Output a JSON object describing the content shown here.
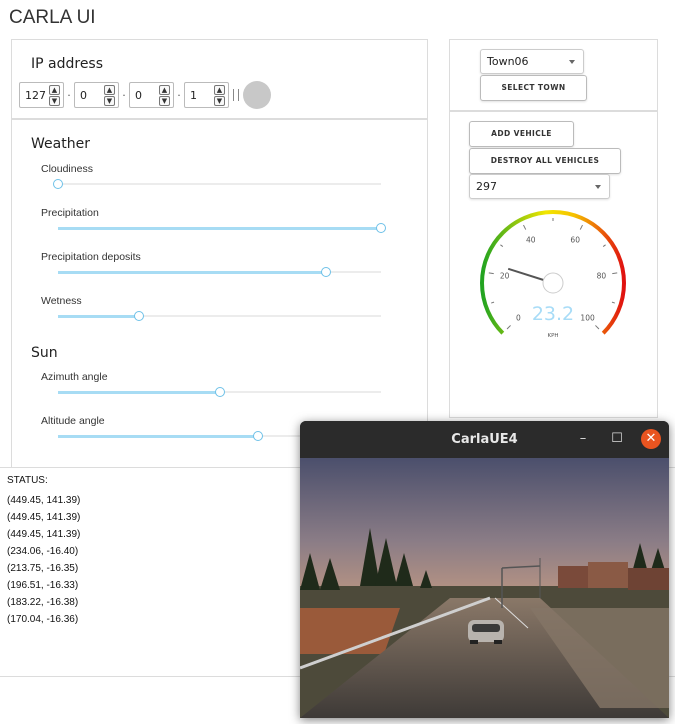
{
  "app": {
    "title": "CARLA UI"
  },
  "ip": {
    "title": "IP address",
    "octets": [
      "127",
      "0",
      "0",
      "1"
    ],
    "separator": "·",
    "up_glyph": "▲",
    "down_glyph": "▼"
  },
  "weather": {
    "title": "Weather",
    "sliders": [
      {
        "label": "Cloudiness",
        "value": 0
      },
      {
        "label": "Precipitation",
        "value": 100
      },
      {
        "label": "Precipitation deposits",
        "value": 83
      },
      {
        "label": "Wetness",
        "value": 25
      }
    ]
  },
  "sun": {
    "title": "Sun",
    "sliders": [
      {
        "label": "Azimuth angle",
        "value": 50
      },
      {
        "label": "Altitude angle",
        "value": 62
      }
    ]
  },
  "town": {
    "selected": "Town06",
    "select_button": "SELECT TOWN"
  },
  "vehicle": {
    "add_button": "ADD VEHICLE",
    "destroy_button": "DESTROY ALL VEHICLES",
    "selected_id": "297"
  },
  "speedometer": {
    "value": "23.2",
    "unit": "KPH",
    "min": 0,
    "max": 100,
    "ticks": [
      "0",
      "20",
      "40",
      "60",
      "80",
      "100"
    ],
    "speed_value": 23.2,
    "colors": {
      "low": "#21a321",
      "mid": "#f2e600",
      "high": "#e01010",
      "value": "#a8dcf7"
    }
  },
  "status": {
    "label": "STATUS:",
    "lines": [
      "(449.45, 141.39)",
      "(449.45, 141.39)",
      "(449.45, 141.39)",
      "(234.06, -16.40)",
      "(213.75, -16.35)",
      "(196.51, -16.33)",
      "(183.22, -16.38)",
      "(170.04, -16.36)"
    ]
  },
  "carla_window": {
    "title": "CarlaUE4",
    "minimize_glyph": "–",
    "maximize_glyph": "☐",
    "close_glyph": "✕"
  },
  "theme": {
    "accent": "#a7dcf4",
    "thumb_border": "#6ec1e8"
  }
}
